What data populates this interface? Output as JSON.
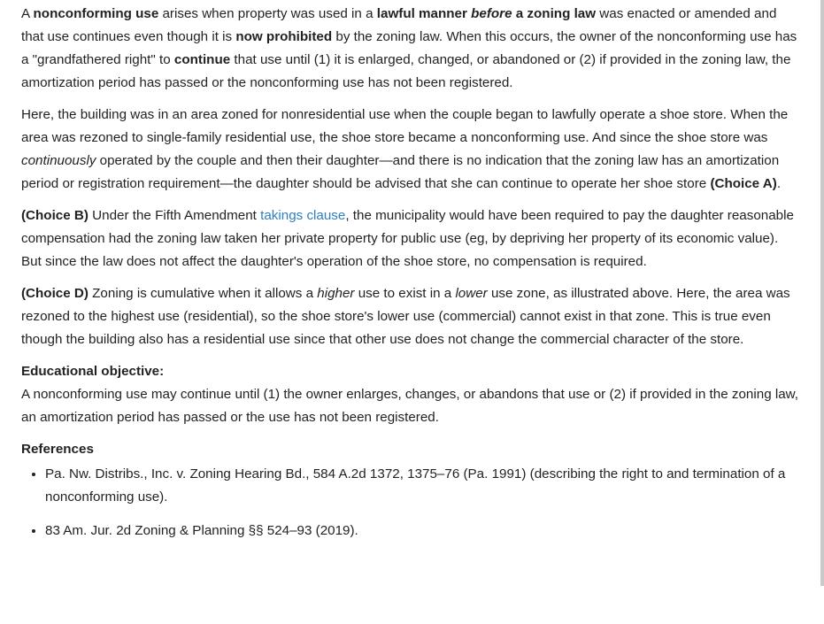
{
  "para1": {
    "s1": "A ",
    "b1": "nonconforming use",
    "s2": " arises when property was used in a ",
    "b2": "lawful manner ",
    "bi1": "before",
    "b3": " a zoning law",
    "s3": " was enacted or amended and that use continues even though it is ",
    "b4": "now prohibited",
    "s4": " by the zoning law.  When this occurs, the owner of the nonconforming use has a \"grandfathered right\" to ",
    "b5": "continue",
    "s5": " that use until (1) it is enlarged, changed, or abandoned or (2) if provided in the zoning law, the amortization period has passed or the nonconforming use has not been registered."
  },
  "para2": {
    "s1": "Here, the building was in an area zoned for nonresidential use when the couple began to lawfully operate a shoe store.  When the area was rezoned to single-family residential use, the shoe store became a nonconforming use.  And since the shoe store was ",
    "i1": "continuously",
    "s2": " operated by the couple and then their daughter—and there is no indication that the zoning law has an amortization period or registration requirement—the daughter should be advised that she can continue to operate her shoe store ",
    "b1": "(Choice A)",
    "s3": "."
  },
  "para3": {
    "b1": "(Choice B)",
    "s1": "  Under the Fifth Amendment ",
    "link": "takings clause",
    "s2": ", the municipality would have been required to pay the daughter reasonable compensation had the zoning law taken her private property for public use (eg, by depriving her property of its economic value).  But since the law does not affect the daughter's operation of the shoe store, no compensation is required."
  },
  "para4": {
    "b1": "(Choice D)",
    "s1": "  Zoning is cumulative when it allows a ",
    "i1": "higher",
    "s2": " use to exist in a ",
    "i2": "lower",
    "s3": " use zone, as illustrated above.  Here, the area was rezoned to the highest use (residential), so the shoe store's lower use (commercial) cannot exist in that zone.  This is true even though the building also has a residential use since that other use does not change the commercial character of the store."
  },
  "objective": {
    "title": "Educational objective:",
    "text": "A nonconforming use may continue until (1) the owner enlarges, changes, or abandons that use or (2) if provided in the zoning law, an amortization period has passed or the use has not been registered."
  },
  "references": {
    "title": "References",
    "items": [
      "Pa. Nw. Distribs., Inc. v. Zoning Hearing Bd., 584 A.2d 1372, 1375–76 (Pa. 1991) (describing the right to and termination of a nonconforming use).",
      "83 Am. Jur. 2d Zoning & Planning §§ 524–93 (2019)."
    ]
  }
}
